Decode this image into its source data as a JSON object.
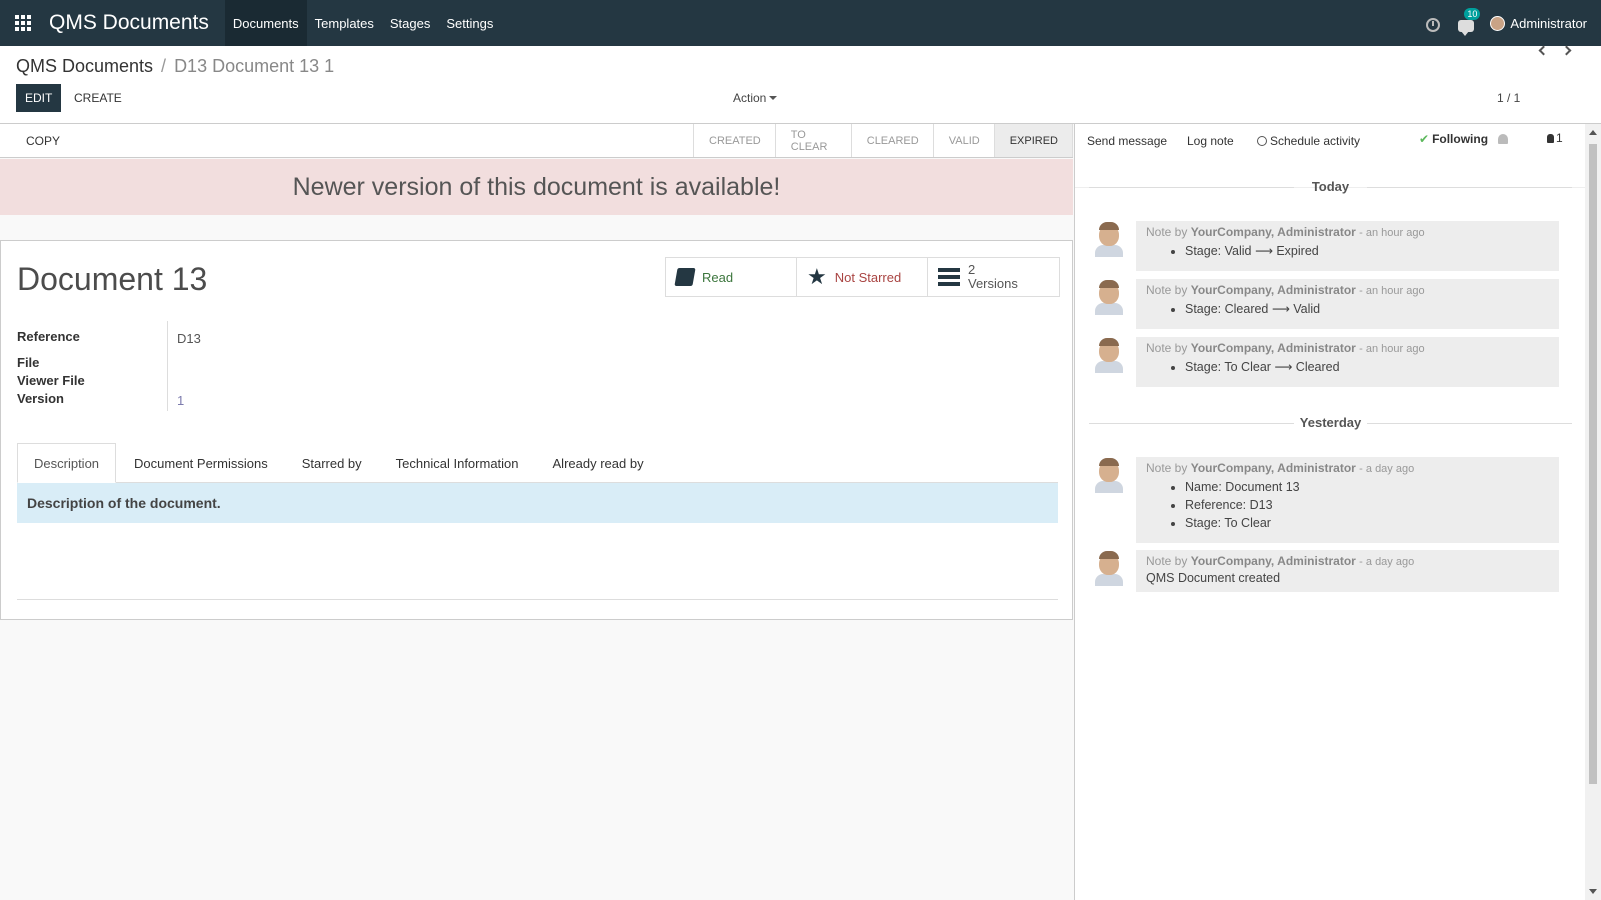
{
  "navbar": {
    "brand": "QMS Documents",
    "menu": [
      "Documents",
      "Templates",
      "Stages",
      "Settings"
    ],
    "active_menu": "Documents",
    "chat_badge": "10",
    "user": "Administrator",
    "bg_color": "#243742"
  },
  "control_panel": {
    "breadcrumb_root": "QMS Documents",
    "breadcrumb_sep": "/",
    "breadcrumb_current": "D13 Document 13 1",
    "edit_label": "EDIT",
    "create_label": "CREATE",
    "action_label": "Action",
    "pager": "1 / 1"
  },
  "statusbar": {
    "copy_label": "COPY",
    "stages": [
      "CREATED",
      "TO CLEAR",
      "CLEARED",
      "VALID",
      "EXPIRED"
    ],
    "active_stage": "EXPIRED"
  },
  "alert": {
    "text": "Newer version of this document is available!"
  },
  "sheet": {
    "title": "Document 13",
    "smart_buttons": {
      "read": "Read",
      "not_starred": "Not Starred",
      "versions_count": "2",
      "versions_label": "Versions"
    },
    "fields": {
      "reference_label": "Reference",
      "reference_value": "D13",
      "file_label": "File",
      "viewer_file_label": "Viewer File",
      "version_label": "Version",
      "version_value": "1"
    },
    "tabs": [
      "Description",
      "Document Permissions",
      "Starred by",
      "Technical Information",
      "Already read by"
    ],
    "active_tab": "Description",
    "description": "Description of the document."
  },
  "chatter": {
    "send_message": "Send message",
    "log_note": "Log note",
    "schedule_activity": "Schedule activity",
    "following": "Following",
    "followers_count": "1",
    "today_label": "Today",
    "yesterday_label": "Yesterday",
    "messages": [
      {
        "prefix": "Note by",
        "author": "YourCompany, Administrator",
        "date": "- an hour ago",
        "items": [
          "Stage: Valid ⟶ Expired"
        ]
      },
      {
        "prefix": "Note by",
        "author": "YourCompany, Administrator",
        "date": "- an hour ago",
        "items": [
          "Stage: Cleared ⟶ Valid"
        ]
      },
      {
        "prefix": "Note by",
        "author": "YourCompany, Administrator",
        "date": "- an hour ago",
        "items": [
          "Stage: To Clear ⟶ Cleared"
        ]
      },
      {
        "prefix": "Note by",
        "author": "YourCompany, Administrator",
        "date": "- a day ago",
        "items": [
          "Name: Document 13",
          "Reference: D13",
          "Stage: To Clear"
        ]
      },
      {
        "prefix": "Note by",
        "author": "YourCompany, Administrator",
        "date": "- a day ago",
        "body": "QMS Document created"
      }
    ]
  }
}
